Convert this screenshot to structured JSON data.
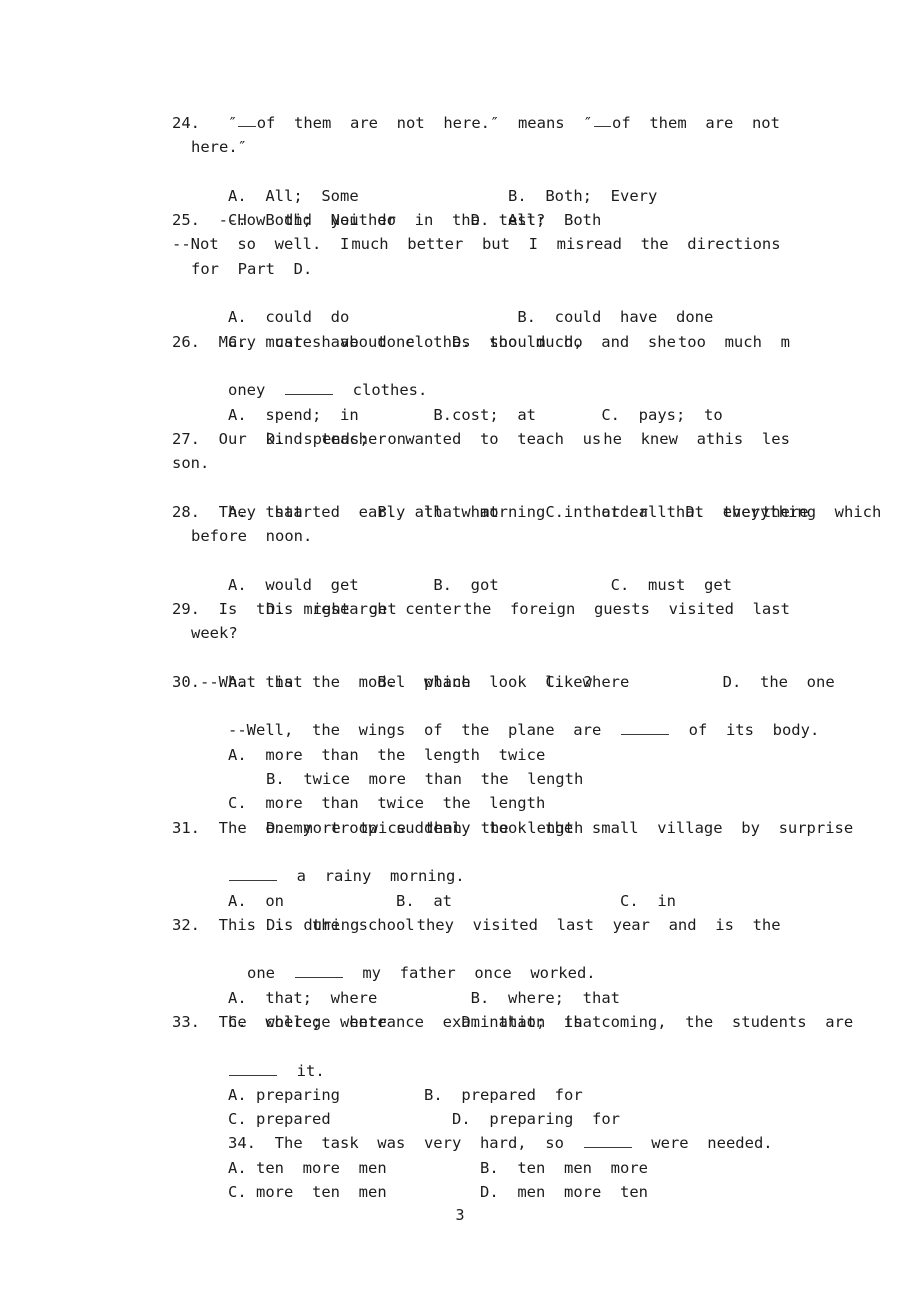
{
  "document": {
    "page_number": "3",
    "type": "english-grammar-multiple-choice-worksheet",
    "question_range": "24-34"
  },
  "quote_glyph": "″",
  "questions": [
    {
      "number": "24.",
      "stem_line1_a": "24.   ″",
      "stem_line1_b": "of  them  are  not  here.″  means  ″",
      "stem_line1_c": "of  them  are  not",
      "stem_line2": "here.″",
      "options": [
        {
          "label": "A.",
          "text": "All;  Some"
        },
        {
          "label": "B.",
          "text": "Both;  Every"
        },
        {
          "label": "C.",
          "text": "Both;  Neither"
        },
        {
          "label": "D.",
          "text": "All;  Both"
        }
      ]
    },
    {
      "number": "25.",
      "stem_line1": "25.  --How  did  you  do  in  the  test?",
      "stem_line2_a": "--Not  so  well.  I",
      "stem_line2_b": "much  better  but  I  misread  the  directions",
      "stem_line3": "for  Part  D.",
      "options": [
        {
          "label": "A.",
          "text": "could  do"
        },
        {
          "label": "B.",
          "text": "could  have  done"
        },
        {
          "label": "C.",
          "text": "must  have  done"
        },
        {
          "label": "D.",
          "text": "should  do"
        }
      ]
    },
    {
      "number": "26.",
      "stem_line1_a": "26.  Mary  cares  about  clothes  too  much,  and  she",
      "stem_line1_b": "too  much  m",
      "stem_line2_a": "oney",
      "stem_line2_b": "clothes.",
      "options": [
        {
          "label": "A.",
          "text": "spend;  in"
        },
        {
          "label": "B.",
          "text": "cost;  at"
        },
        {
          "label": "C.",
          "text": "pays;  to"
        },
        {
          "label": "D.",
          "text": "spends;  on"
        }
      ]
    },
    {
      "number": "27.",
      "stem_line1_a": "27.  Our  kind  teacher  wanted  to  teach  us",
      "stem_line1_b": "he  knew  athis  les",
      "stem_line2": "son.",
      "options": [
        {
          "label": "A.",
          "text": "that"
        },
        {
          "label": "B.",
          "text": "all  what"
        },
        {
          "label": "C.",
          "text": "that  all"
        },
        {
          "label": "D.",
          "text": "everything  which"
        }
      ]
    },
    {
      "number": "28.",
      "stem_line1_a": "28.  They  started  early  that  morning  in  order  that  they",
      "stem_line1_b": "there",
      "stem_line2": "before  noon.",
      "options": [
        {
          "label": "A.",
          "text": "would  get"
        },
        {
          "label": "B.",
          "text": "got"
        },
        {
          "label": "C.",
          "text": "must  get"
        },
        {
          "label": "D.",
          "text": "might  get"
        }
      ]
    },
    {
      "number": "29.",
      "stem_line1_a": "29.  Is  this  research  center",
      "stem_line1_b": "the  foreign  guests  visited  last",
      "stem_line2": "week?",
      "options": [
        {
          "label": "A.",
          "text": "that"
        },
        {
          "label": "B.",
          "text": "which"
        },
        {
          "label": "C.",
          "text": "where"
        },
        {
          "label": "D.",
          "text": "the  one"
        }
      ]
    },
    {
      "number": "30.",
      "stem_line1": "30.--What  is  the  model  plane  look  like?",
      "stem_line2_a": "--Well,  the  wings  of  the  plane  are",
      "stem_line2_b": "of  its  body.",
      "options": [
        {
          "label": "A.",
          "text": "more  than  the  length  twice"
        },
        {
          "label": "B.",
          "text": "twice  more  than  the  length"
        },
        {
          "label": "C.",
          "text": "more  than  twice  the  length"
        },
        {
          "label": "D.",
          "text": "more  twice  than  the  length"
        }
      ]
    },
    {
      "number": "31.",
      "stem_line1": "31.  The  enemy  troop  suddenly  took  the  small  village  by  surprise",
      "stem_line2_b": "a  rainy  morning.",
      "options": [
        {
          "label": "A.",
          "text": "on"
        },
        {
          "label": "B.",
          "text": "at"
        },
        {
          "label": "C.",
          "text": "in"
        },
        {
          "label": "D.",
          "text": "during"
        }
      ]
    },
    {
      "number": "32.",
      "stem_line1_a": "32.  This  is  the  school",
      "stem_line1_b": "they  visited  last  year  and  is  the",
      "stem_line2_a": "one",
      "stem_line2_b": "my  father  once  worked.",
      "options": [
        {
          "label": "A.",
          "text": "that;  where"
        },
        {
          "label": "B.",
          "text": "where;  that"
        },
        {
          "label": "C.",
          "text": "where;  where"
        },
        {
          "label": "D.",
          "text": "that;  that"
        }
      ]
    },
    {
      "number": "33.",
      "stem_line1": "33.  The  college  entrance  examination  is  coming,  the  students  are",
      "stem_line2_b": "it.",
      "options": [
        {
          "label": "A.",
          "text": "preparing"
        },
        {
          "label": "B.",
          "text": "prepared  for"
        },
        {
          "label": "C.",
          "text": "prepared"
        },
        {
          "label": "D.",
          "text": "preparing  for"
        }
      ]
    },
    {
      "number": "34.",
      "stem_line1_a": "34.  The  task  was  very  hard,  so",
      "stem_line1_b": "were  needed.",
      "options": [
        {
          "label": "A.",
          "text": "ten  more  men"
        },
        {
          "label": "B.",
          "text": "ten  men  more"
        },
        {
          "label": "C.",
          "text": "more  ten  men"
        },
        {
          "label": "D.",
          "text": "men  more  ten"
        }
      ]
    }
  ]
}
